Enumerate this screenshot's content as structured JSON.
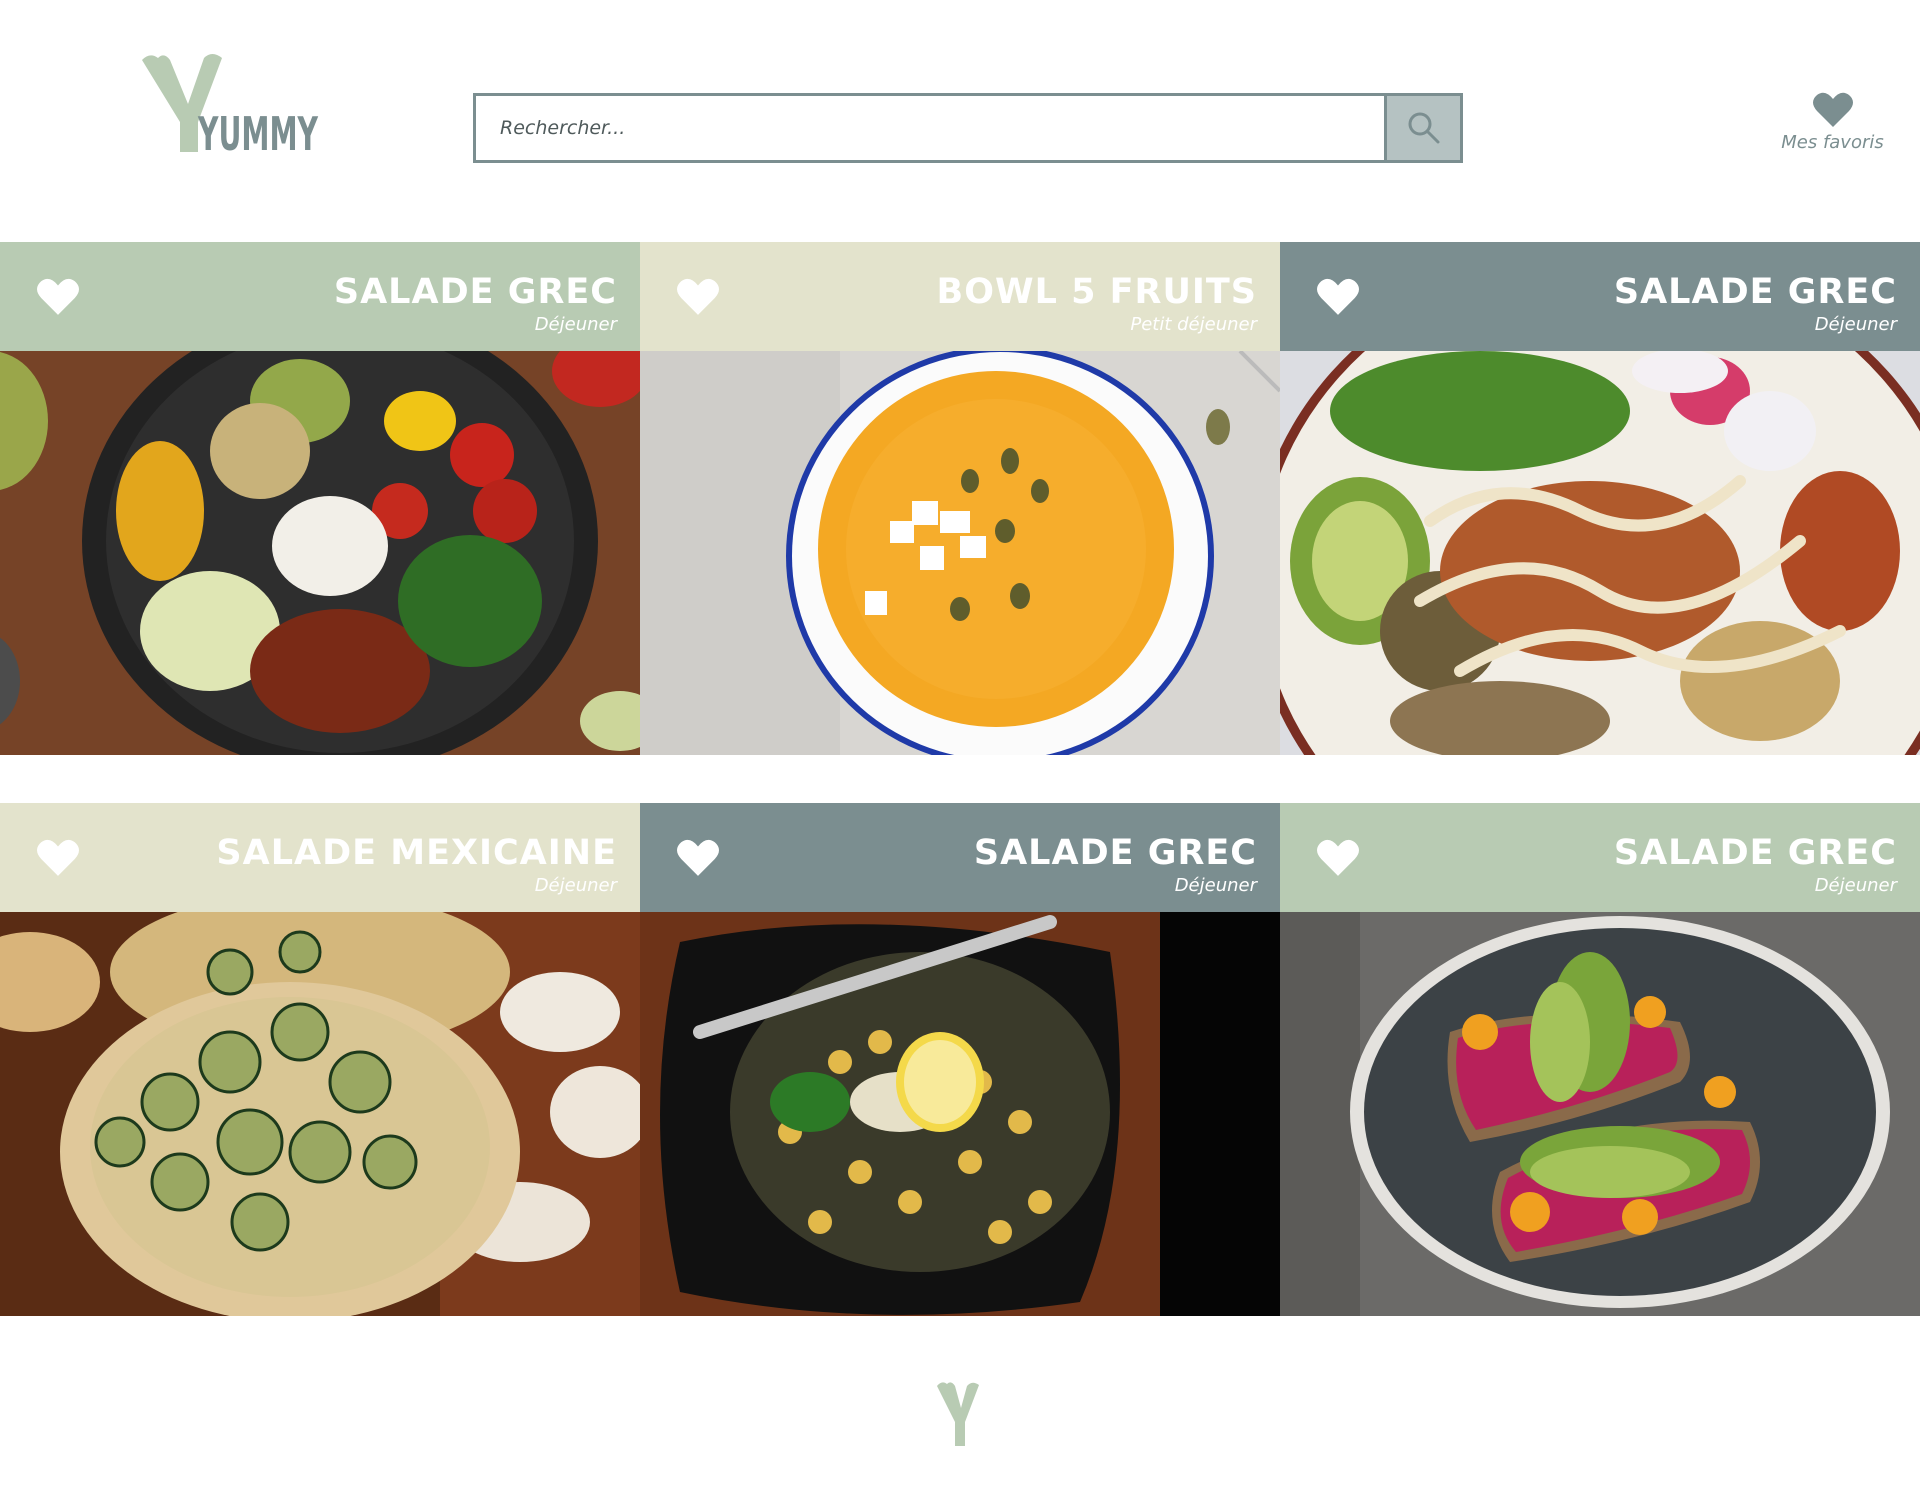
{
  "header": {
    "logo_text": "YUMMY",
    "search": {
      "placeholder": "Rechercher...",
      "value": ""
    },
    "search_button_icon": "search-icon",
    "favorites": {
      "label": "Mes favoris",
      "icon": "heart-icon"
    }
  },
  "colors": {
    "sage": "#b8cbb3",
    "cream": "#e3e3cc",
    "slate": "#7b8e90",
    "white": "#ffffff"
  },
  "recipes": [
    {
      "title": "SALADE GREC",
      "meal": "Déjeuner",
      "header_color": "sage",
      "image": "buddha-bowl-photo"
    },
    {
      "title": "BOWL 5 FRUITS",
      "meal": "Petit déjeuner",
      "header_color": "cream",
      "image": "pumpkin-soup-photo"
    },
    {
      "title": "SALADE GREC",
      "meal": "Déjeuner",
      "header_color": "slate",
      "image": "chickpea-bowl-photo"
    },
    {
      "title": "SALADE MEXICAINE",
      "meal": "Déjeuner",
      "header_color": "cream",
      "image": "zucchini-flatbread-photo"
    },
    {
      "title": "SALADE GREC",
      "meal": "Déjeuner",
      "header_color": "slate",
      "image": "chickpea-salad-photo"
    },
    {
      "title": "SALADE GREC",
      "meal": "Déjeuner",
      "header_color": "sage",
      "image": "avocado-toast-photo"
    }
  ],
  "footer": {
    "logo_text": "Y"
  }
}
